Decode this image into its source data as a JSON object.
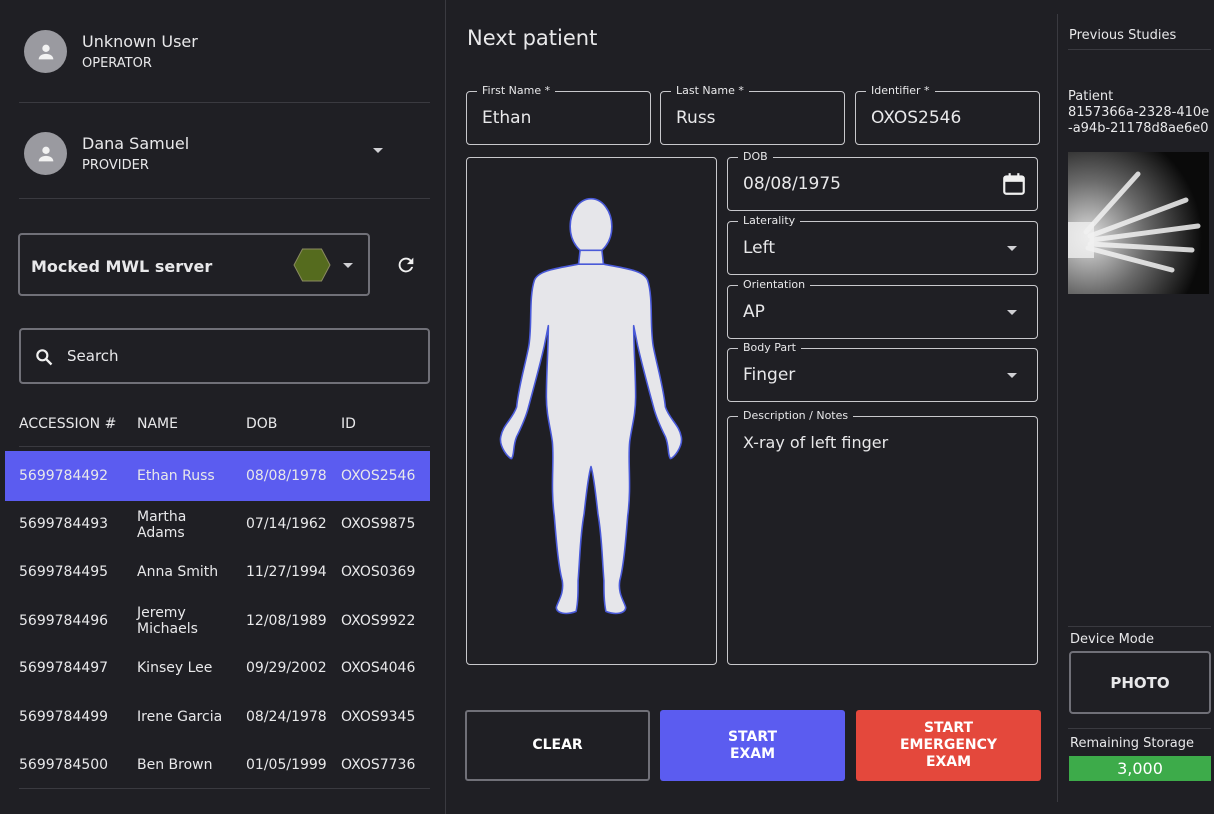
{
  "operator": {
    "name": "Unknown User",
    "role": "OPERATOR"
  },
  "provider": {
    "name": "Dana Samuel",
    "role": "PROVIDER"
  },
  "server": {
    "label": "Mocked MWL server",
    "status_color": "#556b1e"
  },
  "search": {
    "placeholder": "Search"
  },
  "worklist": {
    "columns": [
      "ACCESSION #",
      "NAME",
      "DOB",
      "ID"
    ],
    "rows": [
      {
        "accession": "5699784492",
        "name": "Ethan Russ",
        "dob": "08/08/1978",
        "id": "OXOS2546",
        "selected": true
      },
      {
        "accession": "5699784493",
        "name": "Martha Adams",
        "dob": "07/14/1962",
        "id": "OXOS9875",
        "selected": false
      },
      {
        "accession": "5699784495",
        "name": "Anna Smith",
        "dob": "11/27/1994",
        "id": "OXOS0369",
        "selected": false
      },
      {
        "accession": "5699784496",
        "name": "Jeremy Michaels",
        "dob": "12/08/1989",
        "id": "OXOS9922",
        "selected": false
      },
      {
        "accession": "5699784497",
        "name": "Kinsey Lee",
        "dob": "09/29/2002",
        "id": "OXOS4046",
        "selected": false
      },
      {
        "accession": "5699784499",
        "name": "Irene Garcia",
        "dob": "08/24/1978",
        "id": "OXOS9345",
        "selected": false
      },
      {
        "accession": "5699784500",
        "name": "Ben Brown",
        "dob": "01/05/1999",
        "id": "OXOS7736",
        "selected": false
      }
    ]
  },
  "form": {
    "title": "Next patient",
    "first_name": {
      "label": "First Name *",
      "value": "Ethan"
    },
    "last_name": {
      "label": "Last Name *",
      "value": "Russ"
    },
    "identifier": {
      "label": "Identifier *",
      "value": "OXOS2546"
    },
    "dob": {
      "label": "DOB",
      "value": "08/08/1975"
    },
    "laterality": {
      "label": "Laterality",
      "value": "Left"
    },
    "orientation": {
      "label": "Orientation",
      "value": "AP"
    },
    "body_part": {
      "label": "Body Part",
      "value": "Finger"
    },
    "notes": {
      "label": "Description / Notes",
      "value": "X-ray of left finger"
    }
  },
  "actions": {
    "clear": "CLEAR",
    "start": "START\nEXAM",
    "emergency": "START\nEMERGENCY\nEXAM"
  },
  "colors": {
    "accent": "#5b5cf0",
    "emergency": "#e4483c",
    "storage": "#3dab4a"
  },
  "previous": {
    "title": "Previous Studies",
    "patient_label": "Patient",
    "patient_id": "8157366a-2328-410e-a94b-21178d8ae6e0"
  },
  "device": {
    "title": "Device Mode",
    "mode": "PHOTO"
  },
  "storage": {
    "title": "Remaining Storage",
    "value": "3,000"
  }
}
